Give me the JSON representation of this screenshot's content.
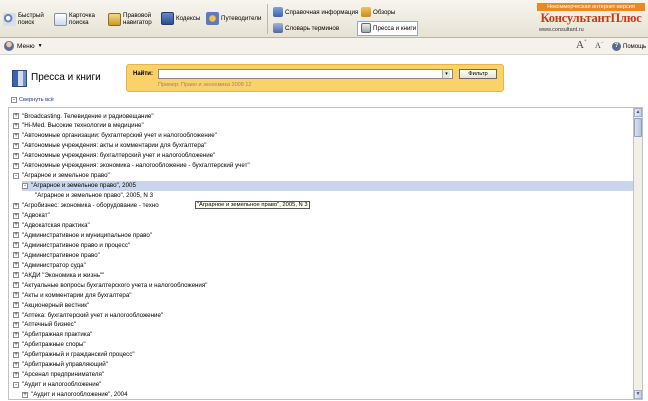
{
  "toolbar": {
    "quick_search": "Быстрый\nпоиск",
    "card_search": "Карточка\nпоиска",
    "legal_navigator": "Правовой\nнавигатор",
    "codes": "Кодексы",
    "guides": "Путеводители",
    "reference_info": "Справочная информация",
    "term_dictionary": "Словарь терминов",
    "reviews": "Обзоры",
    "press_and_books": "Пресса и книги"
  },
  "brand": {
    "tagline": "Некоммерческая интернет-версия",
    "name": "КонсультантПлюс",
    "url": "www.consultant.ru"
  },
  "menubar": {
    "menu_label": "Меню",
    "font_larger": "A",
    "font_smaller": "A",
    "help_label": "Помощь"
  },
  "header": {
    "title": "Пресса и книги",
    "search_label": "Найти:",
    "search_value": "",
    "search_hint": "Пример: Право и экономика 2008 12",
    "filter_button": "Фильтр",
    "collapse_all": "Свернуть всё"
  },
  "tree": {
    "tooltip": "\"Аграрное и земельное право\", 2005, N 3",
    "rows": [
      {
        "sign": "+",
        "level": 0,
        "text": "\"Broadcasting. Телевидение и радиовещание\""
      },
      {
        "sign": "+",
        "level": 0,
        "text": "\"Hi-Med. Высокие технологии в медицине\""
      },
      {
        "sign": "+",
        "level": 0,
        "text": "\"Автономные организации: бухгалтерский учет и налогообложение\""
      },
      {
        "sign": "+",
        "level": 0,
        "text": "\"Автономные учреждения: акты и комментарии для бухгалтера\""
      },
      {
        "sign": "+",
        "level": 0,
        "text": "\"Автономные учреждения: бухгалтерский учет и налогообложение\""
      },
      {
        "sign": "+",
        "level": 0,
        "text": "\"Автономные учреждения: экономика - налогообложение - бухгалтерский учет\""
      },
      {
        "sign": "-",
        "level": 0,
        "text": "\"Аграрное и земельное право\""
      },
      {
        "sign": "-",
        "level": 1,
        "text": "\"Аграрное и земельное право\", 2005",
        "selected": true
      },
      {
        "sign": "",
        "level": 2,
        "text": "\"Аграрное и земельное право\", 2005, N 3"
      },
      {
        "sign": "+",
        "level": 0,
        "text": "\"Агробизнес: экономика - оборудование - техно"
      },
      {
        "sign": "+",
        "level": 0,
        "text": "\"Адвокат\""
      },
      {
        "sign": "+",
        "level": 0,
        "text": "\"Адвокатская практика\""
      },
      {
        "sign": "+",
        "level": 0,
        "text": "\"Административное и муниципальное право\""
      },
      {
        "sign": "+",
        "level": 0,
        "text": "\"Административное право и процесс\""
      },
      {
        "sign": "+",
        "level": 0,
        "text": "\"Административное право\""
      },
      {
        "sign": "+",
        "level": 0,
        "text": "\"Администратор суда\""
      },
      {
        "sign": "+",
        "level": 0,
        "text": "\"АКДИ \"Экономика и жизнь\"\""
      },
      {
        "sign": "+",
        "level": 0,
        "text": "\"Актуальные вопросы бухгалтерского учета и налогообложения\""
      },
      {
        "sign": "+",
        "level": 0,
        "text": "\"Акты и комментарии для бухгалтера\""
      },
      {
        "sign": "+",
        "level": 0,
        "text": "\"Акционерный вестник\""
      },
      {
        "sign": "+",
        "level": 0,
        "text": "\"Аптека: бухгалтерский учет и налогообложение\""
      },
      {
        "sign": "+",
        "level": 0,
        "text": "\"Аптечный бизнес\""
      },
      {
        "sign": "+",
        "level": 0,
        "text": "\"Арбитражная практика\""
      },
      {
        "sign": "+",
        "level": 0,
        "text": "\"Арбитражные споры\""
      },
      {
        "sign": "+",
        "level": 0,
        "text": "\"Арбитражный и гражданский процесс\""
      },
      {
        "sign": "+",
        "level": 0,
        "text": "\"Арбитражный управляющий\""
      },
      {
        "sign": "+",
        "level": 0,
        "text": "\"Арсенал предпринимателя\""
      },
      {
        "sign": "-",
        "level": 0,
        "text": "\"Аудит и налогообложение\""
      },
      {
        "sign": "+",
        "level": 1,
        "text": "\"Аудит и налогообложение\", 2004"
      }
    ]
  }
}
